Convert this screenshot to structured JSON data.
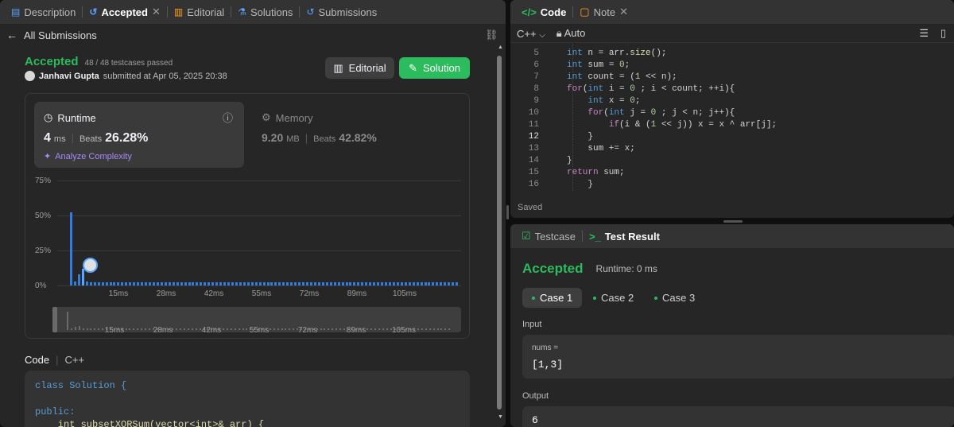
{
  "left_tabs": [
    "Description",
    "Accepted",
    "Editorial",
    "Solutions",
    "Submissions"
  ],
  "back_label": "All Submissions",
  "status": {
    "label": "Accepted",
    "testcases": "48 / 48 testcases passed"
  },
  "submitter": {
    "name": "Janhavi Gupta",
    "submitted": "submitted at Apr 05, 2025 20:38"
  },
  "buttons": {
    "editorial": "Editorial",
    "solution": "Solution"
  },
  "runtime": {
    "title": "Runtime",
    "value": "4",
    "unit": "ms",
    "beats_label": "Beats",
    "beats": "26.28%",
    "analyze": "Analyze Complexity"
  },
  "memory": {
    "title": "Memory",
    "value": "9.20",
    "unit": "MB",
    "beats_label": "Beats",
    "beats": "42.82%"
  },
  "chart_data": {
    "type": "bar",
    "ylabel_ticks": [
      "75%",
      "50%",
      "25%",
      "0%"
    ],
    "xlabel_ticks": [
      "15ms",
      "28ms",
      "42ms",
      "55ms",
      "72ms",
      "89ms",
      "105ms"
    ],
    "ylim": [
      0,
      75
    ],
    "values": [
      52,
      3,
      8,
      12,
      3,
      2,
      2,
      2,
      2,
      2,
      2,
      2,
      2,
      2,
      2,
      2,
      2,
      2,
      2,
      2,
      2,
      2,
      2,
      2,
      2,
      2,
      2,
      2,
      2,
      2,
      2,
      2,
      2,
      2,
      2,
      2,
      2,
      2,
      2,
      2,
      2,
      2,
      2,
      2,
      2,
      2,
      2,
      2,
      2,
      2,
      2,
      2,
      2,
      2,
      2,
      2,
      2,
      2,
      2,
      2,
      2,
      2,
      2,
      2,
      2,
      2,
      2,
      2,
      2,
      2,
      2,
      2,
      2,
      2,
      2,
      2,
      2,
      2,
      2,
      2,
      2,
      2,
      2,
      2,
      2,
      2,
      2,
      2,
      2,
      2,
      2,
      2,
      2,
      2,
      2,
      2,
      2,
      2,
      2
    ],
    "highlight_index": 3,
    "grid": true
  },
  "code_section": {
    "label": "Code",
    "lang": "C++",
    "lines": [
      "class Solution {",
      "",
      "public:",
      "    int subsetXORSum(vector<int>& arr) {"
    ]
  },
  "editor": {
    "tabs": [
      "Code",
      "Note"
    ],
    "lang": "C++",
    "mode": "Auto",
    "saved": "Saved",
    "lines": [
      {
        "n": "5",
        "t": "        int n = arr.size();"
      },
      {
        "n": "6",
        "t": "        int sum = 0;"
      },
      {
        "n": "7",
        "t": "        int count = (1 << n);"
      },
      {
        "n": "8",
        "t": "        for(int i = 0 ; i < count; ++i){"
      },
      {
        "n": "9",
        "t": "            int x = 0;"
      },
      {
        "n": "10",
        "t": "            for(int j = 0 ; j < n; j++){"
      },
      {
        "n": "11",
        "t": "                if(i & (1 << j)) x = x ^ arr[j];"
      },
      {
        "n": "12",
        "t": "            }"
      },
      {
        "n": "13",
        "t": "            sum += x;"
      },
      {
        "n": "14",
        "t": "        }"
      },
      {
        "n": "15",
        "t": "        return sum;"
      },
      {
        "n": "16",
        "t": "    }"
      }
    ]
  },
  "result": {
    "tabs": [
      "Testcase",
      "Test Result"
    ],
    "status": "Accepted",
    "runtime": "Runtime: 0 ms",
    "cases": [
      "Case 1",
      "Case 2",
      "Case 3"
    ],
    "input_label": "Input",
    "input_var": "nums =",
    "input_val": "[1,3]",
    "output_label": "Output",
    "output_val": "6"
  }
}
